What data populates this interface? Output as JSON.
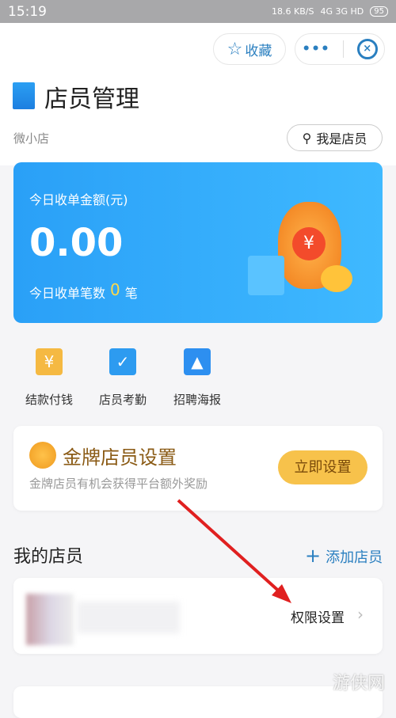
{
  "status_bar": {
    "time": "15:19",
    "net_speed": "18.6 KB/S",
    "network": "4G 3G HD",
    "battery": "95"
  },
  "header": {
    "favorite_label": "收藏",
    "more_icon": "more-dots-icon",
    "close_icon": "close-circle-icon",
    "title": "店员管理",
    "shop_name": "微小店",
    "role_button": "我是店员"
  },
  "summary": {
    "amount_label": "今日收单金额(元)",
    "amount": "0.00",
    "count_prefix": "今日收单笔数",
    "count": "0",
    "count_suffix": "笔"
  },
  "quick_actions": [
    {
      "label": "结款付钱",
      "icon": "yen-clipboard-icon",
      "color": "#f5b942"
    },
    {
      "label": "店员考勤",
      "icon": "calendar-check-icon",
      "color": "#2d9bf0"
    },
    {
      "label": "招聘海报",
      "icon": "poster-image-icon",
      "color": "#2d8ff0"
    }
  ],
  "gold": {
    "title": "金牌店员设置",
    "desc": "金牌店员有机会获得平台额外奖励",
    "button": "立即设置"
  },
  "members": {
    "title": "我的店员",
    "add_label": "添加店员",
    "items": [
      {
        "action": "权限设置"
      }
    ]
  },
  "watermark": "游侠网",
  "colors": {
    "accent": "#2a7fc0",
    "gold_button": "#f7c24b",
    "arrow": "#e02020"
  }
}
